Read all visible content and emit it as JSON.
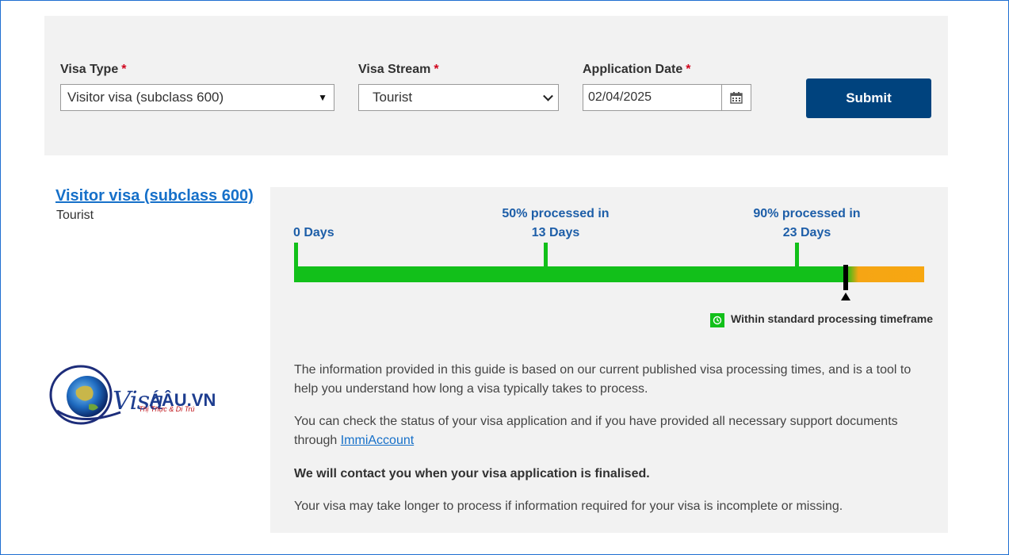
{
  "form": {
    "visa_type": {
      "label": "Visa Type",
      "required": "*",
      "value": "Visitor visa (subclass 600)"
    },
    "visa_stream": {
      "label": "Visa Stream",
      "required": "*",
      "value": "Tourist"
    },
    "application_date": {
      "label": "Application Date",
      "required": "*",
      "value": "02/04/2025"
    },
    "submit_label": "Submit"
  },
  "result": {
    "visa_title": "Visitor visa (subclass 600)",
    "stream": "Tourist"
  },
  "logo": {
    "main": "Visa",
    "suffix": "ÁÂU.VN",
    "tagline": "Thị Thực & Di Trú"
  },
  "timeline": {
    "start_label": "0 Days",
    "p50_line1": "50% processed in",
    "p50_line2": "13 Days",
    "p90_line1": "90% processed in",
    "p90_line2": "23 Days",
    "legend": "Within standard processing timeframe",
    "colors": {
      "within": "#12c01a",
      "beyond": "#f7a711",
      "marker": "#000000"
    }
  },
  "info": {
    "p1": "The information provided in this guide is based on our current published visa processing times, and is a tool to help you understand how long a visa typically takes to process.",
    "p2_text": "You can check the status of your visa application and if you have provided all necessary support documents through ",
    "p2_link": "ImmiAccount",
    "p3": "We will contact you when your visa application is finalised.",
    "p4": "Your visa may take longer to process if information required for your visa is incomplete or missing."
  }
}
